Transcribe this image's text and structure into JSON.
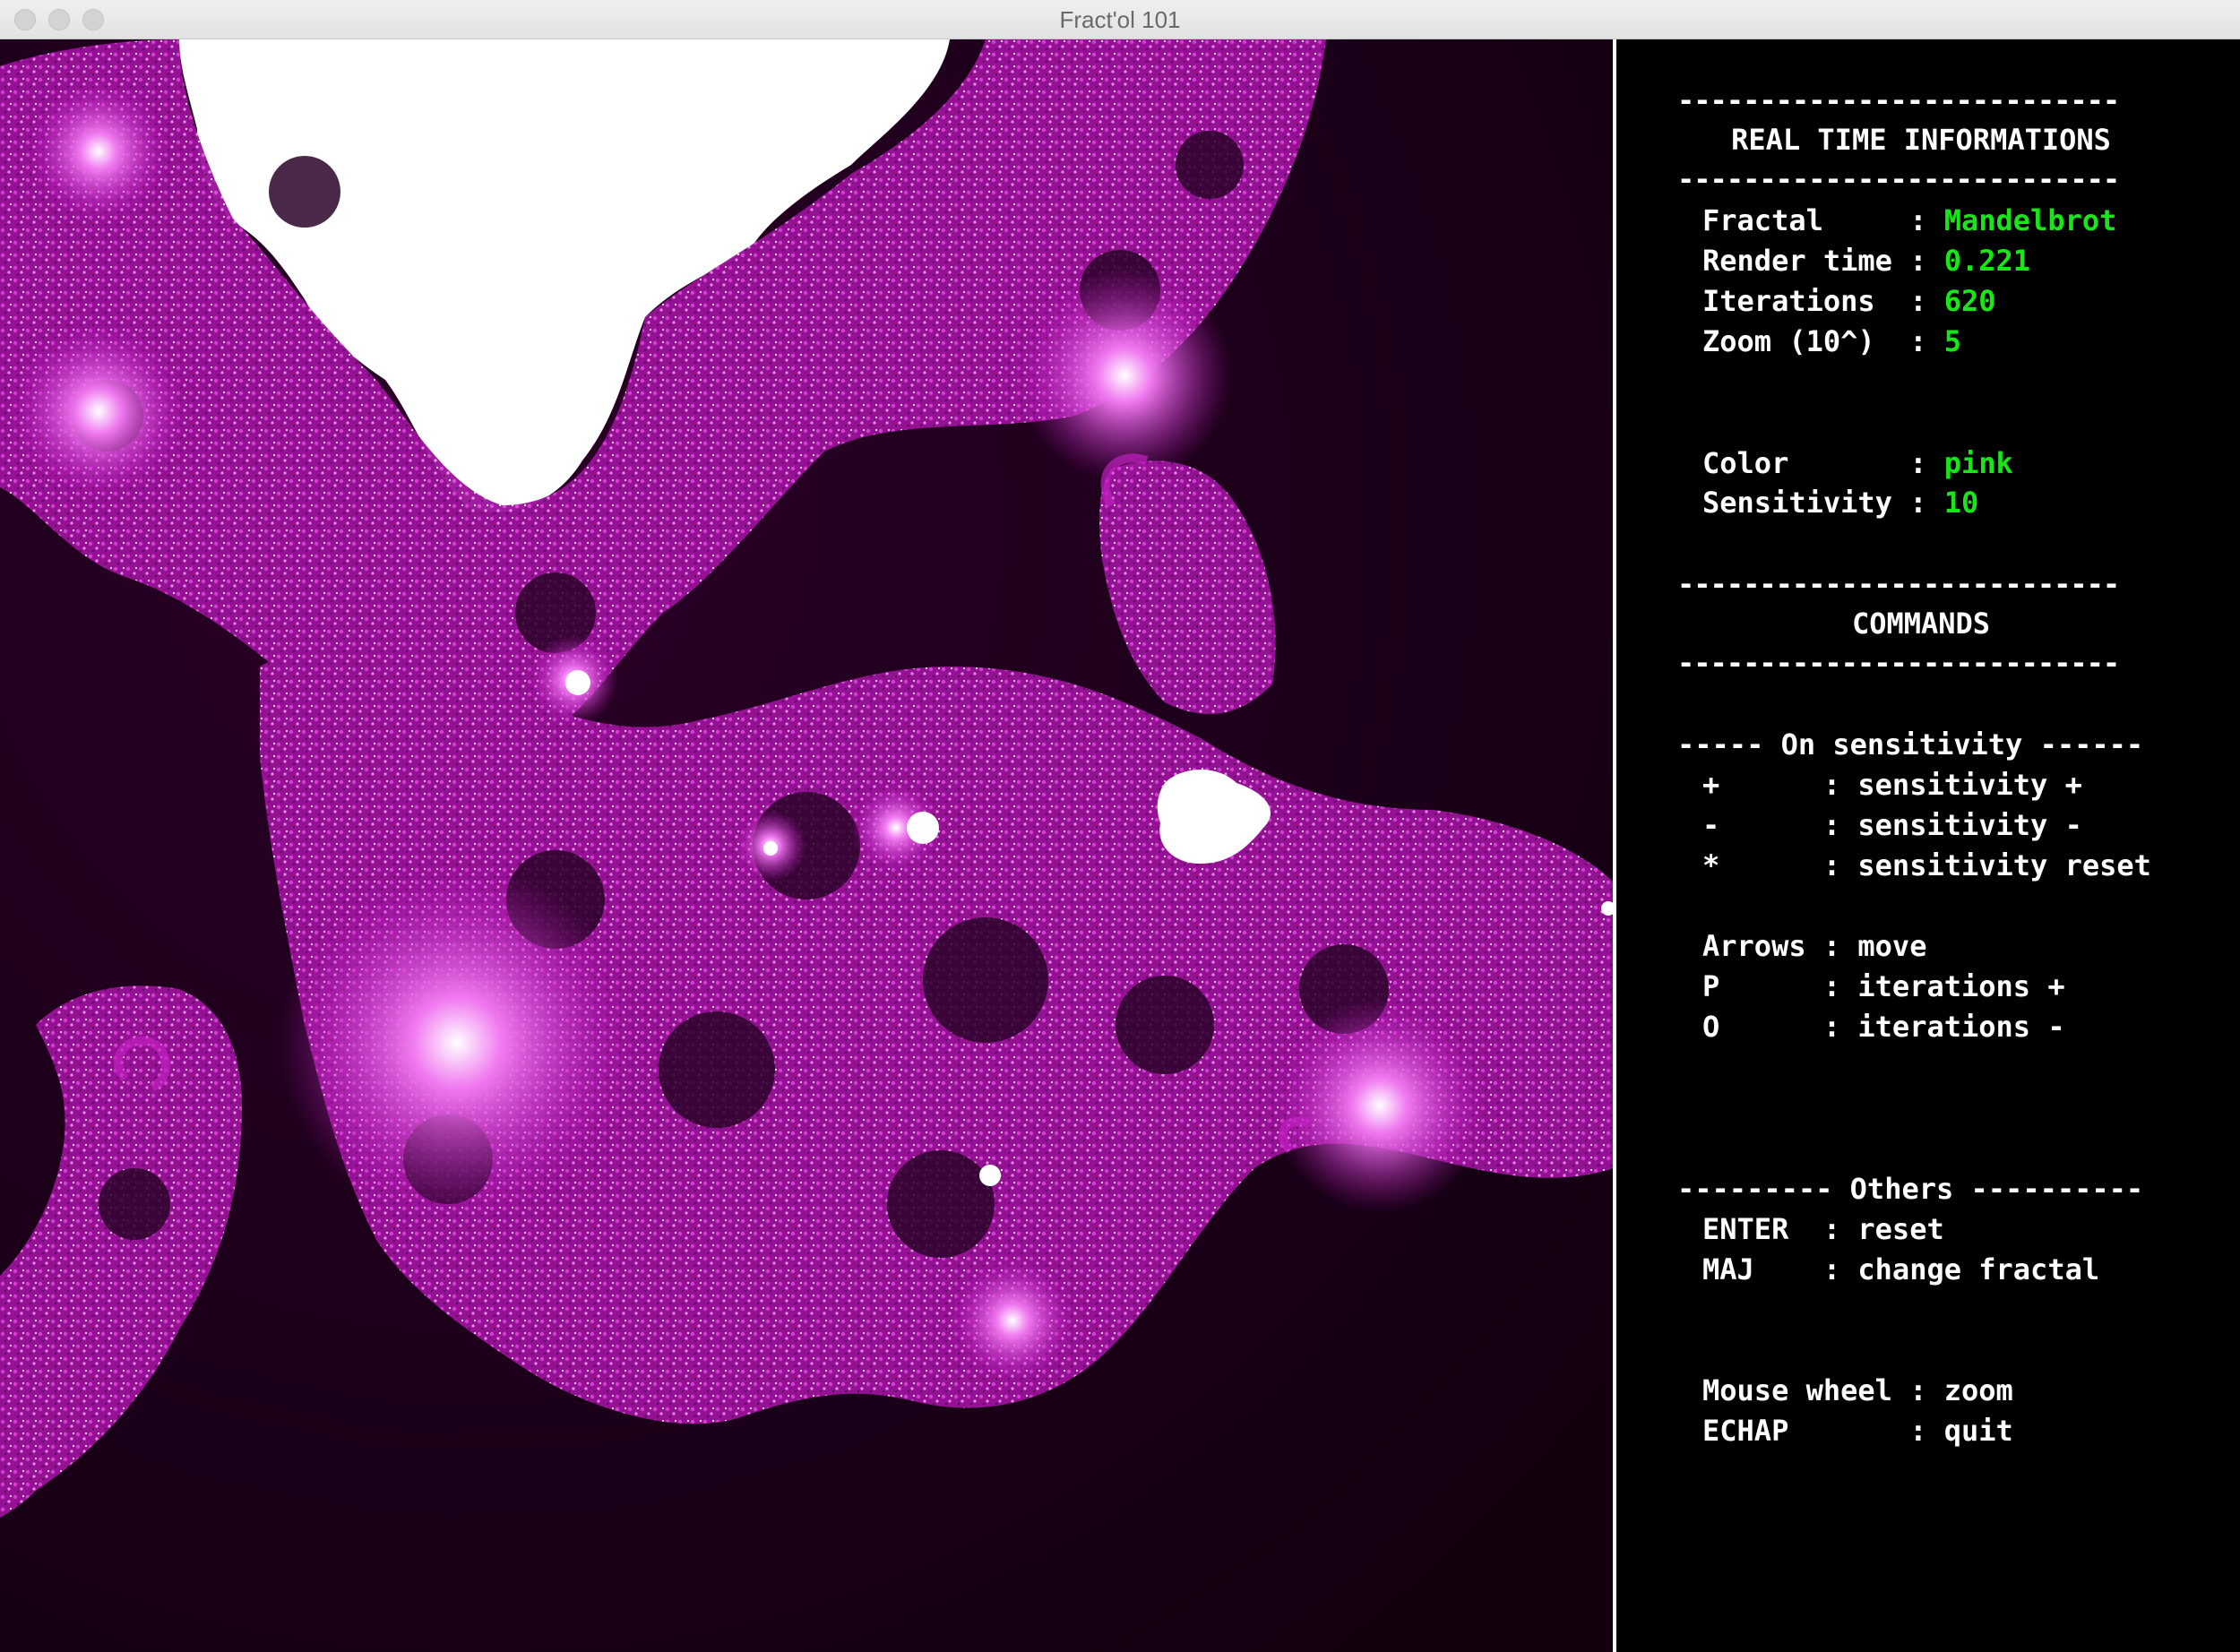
{
  "window": {
    "title": "Fract'ol 101"
  },
  "colors": {
    "fractal_accent": "#d21ad2",
    "fractal_background": "#1c0018",
    "value_green": "#19e619"
  },
  "panel": {
    "separator": "---------------------------",
    "realtime_header": "REAL TIME INFORMATIONS",
    "info": [
      {
        "label": "Fractal     :",
        "value": "Mandelbrot"
      },
      {
        "label": "Render time :",
        "value": "0.221"
      },
      {
        "label": "Iterations  :",
        "value": "620"
      },
      {
        "label": "Zoom (10^)  :",
        "value": "5"
      }
    ],
    "settings": [
      {
        "label": "Color       :",
        "value": "pink"
      },
      {
        "label": "Sensitivity :",
        "value": "10"
      }
    ],
    "commands_header": "COMMANDS",
    "sensitivity_header": "----- On sensitivity ------",
    "sensitivity_commands": [
      "+      : sensitivity +",
      "-      : sensitivity -",
      "*      : sensitivity reset"
    ],
    "move_commands": [
      "Arrows : move",
      "P      : iterations +",
      "O      : iterations -"
    ],
    "others_header": "--------- Others ----------",
    "other_commands": [
      "ENTER  : reset",
      "MAJ    : change fractal"
    ],
    "global_commands": [
      "Mouse wheel : zoom",
      "ECHAP       : quit"
    ]
  }
}
